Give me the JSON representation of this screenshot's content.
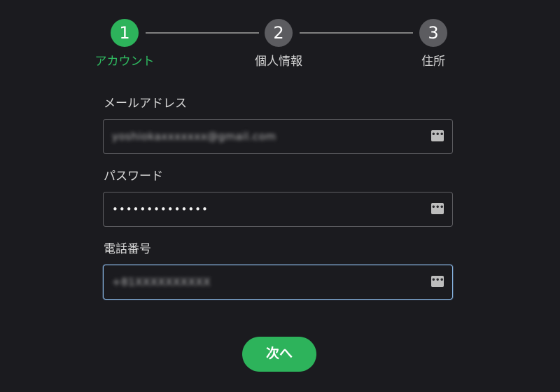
{
  "stepper": {
    "steps": [
      {
        "number": "1",
        "label": "アカウント"
      },
      {
        "number": "2",
        "label": "個人情報"
      },
      {
        "number": "3",
        "label": "住所"
      }
    ],
    "active_step": 1,
    "colors": {
      "active": "#2db35b",
      "inactive": "#5c5c60",
      "line": "#808080"
    }
  },
  "form": {
    "email": {
      "label": "メールアドレス",
      "value": "yoshiokaxxxxxxx@gmail.com",
      "icon": "password-manager-icon"
    },
    "password": {
      "label": "パスワード",
      "value": "••••••••••••••",
      "icon": "password-manager-icon"
    },
    "phone": {
      "label": "電話番号",
      "value": "+81XXXXXXXXXX",
      "icon": "password-manager-icon"
    }
  },
  "actions": {
    "next_label": "次へ"
  },
  "colors": {
    "background": "#1b1b1f",
    "focus_border": "#8ab8e6",
    "primary": "#2db35b"
  }
}
